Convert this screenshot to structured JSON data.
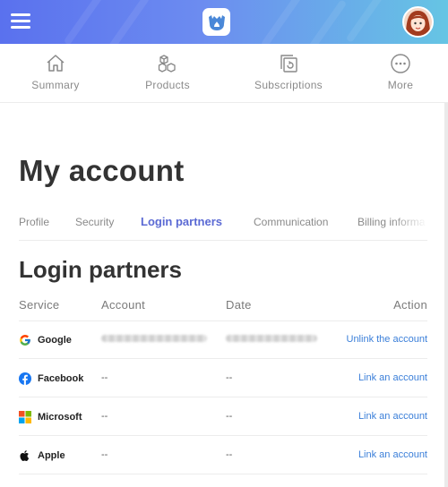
{
  "header": {
    "menu_icon": "hamburger-menu-icon",
    "logo_icon": "fire-pot-logo-icon",
    "avatar_icon": "user-avatar",
    "gradient_colors": [
      "#5a71ee",
      "#66c5e4"
    ]
  },
  "nav": {
    "items": [
      {
        "label": "Summary",
        "icon": "home-icon"
      },
      {
        "label": "Products",
        "icon": "cubes-icon"
      },
      {
        "label": "Subscriptions",
        "icon": "subscriptions-icon"
      },
      {
        "label": "More",
        "icon": "more-dots-icon"
      }
    ]
  },
  "page": {
    "title": "My account"
  },
  "tabs": [
    {
      "label": "Profile",
      "active": false
    },
    {
      "label": "Security",
      "active": false
    },
    {
      "label": "Login partners",
      "active": true
    },
    {
      "label": "Communication",
      "active": false
    },
    {
      "label": "Billing informa",
      "active": false
    }
  ],
  "section": {
    "title": "Login partners"
  },
  "table": {
    "headers": {
      "service": "Service",
      "account": "Account",
      "date": "Date",
      "action": "Action"
    },
    "rows": [
      {
        "service": "Google",
        "icon": "google-icon",
        "account": "",
        "date": "",
        "account_redacted": true,
        "action": "Unlink the account"
      },
      {
        "service": "Facebook",
        "icon": "facebook-icon",
        "account": "--",
        "date": "--",
        "action": "Link an account"
      },
      {
        "service": "Microsoft",
        "icon": "microsoft-icon",
        "account": "--",
        "date": "--",
        "action": "Link an account"
      },
      {
        "service": "Apple",
        "icon": "apple-icon",
        "account": "--",
        "date": "--",
        "action": "Link an account"
      }
    ]
  },
  "colors": {
    "accent": "#5b6ad4",
    "link": "#3b7fd9"
  }
}
